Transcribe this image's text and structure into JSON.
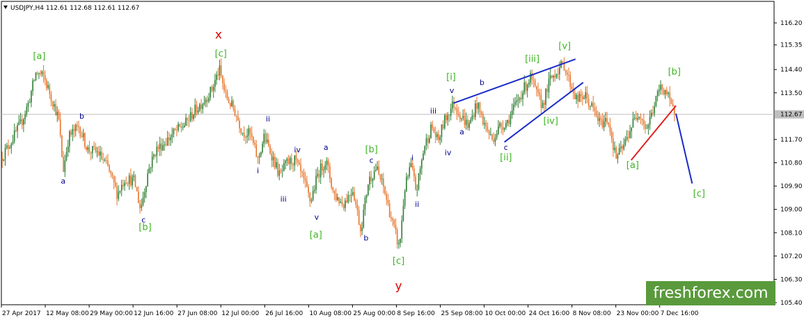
{
  "header": {
    "symbol_line": "USDJPY,H4  112.61 112.68 112.61 112.67"
  },
  "watermark": {
    "text": "freshforex.com"
  },
  "colors": {
    "up_candle": "#2e7d32",
    "down_candle": "#e8742a",
    "label_green": "#3cb521",
    "label_red": "#e00000",
    "label_blue": "#00008b",
    "trendline_blue": "#1a2bc8",
    "trendline_red": "#e02020",
    "price_box": "#c0c0c0"
  },
  "chart_data": {
    "type": "candlestick",
    "title": "USDJPY,H4",
    "ohlc_last": {
      "open": 112.61,
      "high": 112.68,
      "low": 112.61,
      "close": 112.67
    },
    "current_price_label": "112.67",
    "ylim": [
      105.4,
      117.1
    ],
    "xlim": [
      0,
      1
    ],
    "y_ticks": [
      "116.20",
      "115.35",
      "114.40",
      "113.50",
      "112.67",
      "111.70",
      "110.80",
      "109.90",
      "109.00",
      "108.10",
      "107.20",
      "106.30",
      "105.40"
    ],
    "y_tick_values": [
      116.2,
      115.35,
      114.4,
      113.5,
      112.67,
      111.7,
      110.8,
      109.9,
      109.0,
      108.1,
      107.2,
      106.3,
      105.4
    ],
    "x_ticks": [
      "27 Apr 2017",
      "12 May 08:00",
      "29 May 00:00",
      "12 Jun 16:00",
      "27 Jun 08:00",
      "12 Jul 00:00",
      "26 Jul 16:00",
      "10 Aug 08:00",
      "25 Aug 00:00",
      "8 Sep 16:00",
      "25 Sep 08:00",
      "10 Oct 00:00",
      "24 Oct 16:00",
      "8 Nov 08:00",
      "23 Nov 00:00",
      "7 Dec 16:00"
    ],
    "x_tick_values": [
      0.0,
      0.0568,
      0.1136,
      0.1704,
      0.2272,
      0.284,
      0.3408,
      0.3976,
      0.4544,
      0.5112,
      0.568,
      0.6248,
      0.6816,
      0.7384,
      0.7952,
      0.852
    ],
    "price_path": [
      [
        0.0,
        111.0
      ],
      [
        0.012,
        111.6
      ],
      [
        0.025,
        112.3
      ],
      [
        0.035,
        113.1
      ],
      [
        0.045,
        114.3
      ],
      [
        0.055,
        114.1
      ],
      [
        0.065,
        113.3
      ],
      [
        0.074,
        112.5
      ],
      [
        0.08,
        110.5
      ],
      [
        0.087,
        111.8
      ],
      [
        0.1,
        112.2
      ],
      [
        0.112,
        111.3
      ],
      [
        0.125,
        111.2
      ],
      [
        0.138,
        110.6
      ],
      [
        0.15,
        109.6
      ],
      [
        0.16,
        110.2
      ],
      [
        0.172,
        110.1
      ],
      [
        0.18,
        109.0
      ],
      [
        0.19,
        110.5
      ],
      [
        0.2,
        111.3
      ],
      [
        0.212,
        111.6
      ],
      [
        0.225,
        112.0
      ],
      [
        0.238,
        112.3
      ],
      [
        0.25,
        112.8
      ],
      [
        0.262,
        113.2
      ],
      [
        0.272,
        113.6
      ],
      [
        0.282,
        114.4
      ],
      [
        0.29,
        113.4
      ],
      [
        0.302,
        112.8
      ],
      [
        0.312,
        112.0
      ],
      [
        0.322,
        111.9
      ],
      [
        0.332,
        110.9
      ],
      [
        0.34,
        111.8
      ],
      [
        0.35,
        111.1
      ],
      [
        0.36,
        110.3
      ],
      [
        0.37,
        110.8
      ],
      [
        0.38,
        110.9
      ],
      [
        0.39,
        110.2
      ],
      [
        0.4,
        109.3
      ],
      [
        0.41,
        110.4
      ],
      [
        0.42,
        110.9
      ],
      [
        0.43,
        109.6
      ],
      [
        0.442,
        109.2
      ],
      [
        0.455,
        109.8
      ],
      [
        0.465,
        108.2
      ],
      [
        0.475,
        110.1
      ],
      [
        0.485,
        110.6
      ],
      [
        0.495,
        109.8
      ],
      [
        0.505,
        108.6
      ],
      [
        0.515,
        107.5
      ],
      [
        0.522,
        109.8
      ],
      [
        0.53,
        110.7
      ],
      [
        0.537,
        109.7
      ],
      [
        0.547,
        111.4
      ],
      [
        0.557,
        112.2
      ],
      [
        0.565,
        111.6
      ],
      [
        0.573,
        112.4
      ],
      [
        0.585,
        113.1
      ],
      [
        0.595,
        112.6
      ],
      [
        0.605,
        112.2
      ],
      [
        0.615,
        113.1
      ],
      [
        0.625,
        112.3
      ],
      [
        0.635,
        111.7
      ],
      [
        0.645,
        112.2
      ],
      [
        0.655,
        112.4
      ],
      [
        0.665,
        113.0
      ],
      [
        0.675,
        113.6
      ],
      [
        0.685,
        114.1
      ],
      [
        0.692,
        113.5
      ],
      [
        0.7,
        113.0
      ],
      [
        0.71,
        114.0
      ],
      [
        0.72,
        114.4
      ],
      [
        0.728,
        114.6
      ],
      [
        0.736,
        113.9
      ],
      [
        0.745,
        113.2
      ],
      [
        0.755,
        113.4
      ],
      [
        0.765,
        112.9
      ],
      [
        0.775,
        112.3
      ],
      [
        0.785,
        112.5
      ],
      [
        0.795,
        111.0
      ],
      [
        0.805,
        111.4
      ],
      [
        0.815,
        112.2
      ],
      [
        0.825,
        112.8
      ],
      [
        0.835,
        112.1
      ],
      [
        0.845,
        113.0
      ],
      [
        0.852,
        113.7
      ],
      [
        0.86,
        113.6
      ],
      [
        0.866,
        113.0
      ],
      [
        0.872,
        112.67
      ]
    ],
    "trendlines": [
      {
        "color": "blue",
        "from": [
          0.585,
          113.1
        ],
        "to": [
          0.743,
          114.8
        ]
      },
      {
        "color": "blue",
        "from": [
          0.651,
          111.6
        ],
        "to": [
          0.753,
          113.9
        ]
      },
      {
        "color": "red",
        "from": [
          0.815,
          110.9
        ],
        "to": [
          0.873,
          113.0
        ]
      }
    ],
    "projection": {
      "color": "blue",
      "points": [
        [
          0.873,
          112.7
        ],
        [
          0.894,
          110.0
        ]
      ]
    },
    "annotations": [
      {
        "text": "[a]",
        "x": 0.049,
        "y": 114.8,
        "color": "green",
        "size": 13
      },
      {
        "text": "a",
        "x": 0.08,
        "y": 110.0,
        "color": "blue",
        "size": 11
      },
      {
        "text": "b",
        "x": 0.104,
        "y": 112.5,
        "color": "blue",
        "size": 11
      },
      {
        "text": "c",
        "x": 0.184,
        "y": 108.5,
        "color": "blue",
        "size": 11
      },
      {
        "text": "[b]",
        "x": 0.186,
        "y": 108.2,
        "color": "green",
        "size": 13
      },
      {
        "text": "x",
        "x": 0.281,
        "y": 115.6,
        "color": "red",
        "size": 17
      },
      {
        "text": "[c]",
        "x": 0.284,
        "y": 114.9,
        "color": "green",
        "size": 13
      },
      {
        "text": "ii",
        "x": 0.345,
        "y": 112.4,
        "color": "blue",
        "size": 11
      },
      {
        "text": "i",
        "x": 0.332,
        "y": 110.4,
        "color": "blue",
        "size": 11
      },
      {
        "text": "iii",
        "x": 0.365,
        "y": 109.3,
        "color": "blue",
        "size": 11
      },
      {
        "text": "iv",
        "x": 0.383,
        "y": 111.2,
        "color": "blue",
        "size": 11
      },
      {
        "text": "a",
        "x": 0.42,
        "y": 111.3,
        "color": "blue",
        "size": 11
      },
      {
        "text": "v",
        "x": 0.408,
        "y": 108.6,
        "color": "blue",
        "size": 11
      },
      {
        "text": "[a]",
        "x": 0.407,
        "y": 107.9,
        "color": "green",
        "size": 13
      },
      {
        "text": "[b]",
        "x": 0.479,
        "y": 111.2,
        "color": "green",
        "size": 13
      },
      {
        "text": "c",
        "x": 0.479,
        "y": 110.8,
        "color": "blue",
        "size": 11
      },
      {
        "text": "b",
        "x": 0.472,
        "y": 107.8,
        "color": "blue",
        "size": 11
      },
      {
        "text": "[c]",
        "x": 0.514,
        "y": 106.9,
        "color": "green",
        "size": 13
      },
      {
        "text": "y",
        "x": 0.514,
        "y": 105.9,
        "color": "red",
        "size": 17
      },
      {
        "text": "i",
        "x": 0.532,
        "y": 110.9,
        "color": "blue",
        "size": 11
      },
      {
        "text": "ii",
        "x": 0.538,
        "y": 109.1,
        "color": "blue",
        "size": 11
      },
      {
        "text": "iii",
        "x": 0.559,
        "y": 112.7,
        "color": "blue",
        "size": 11
      },
      {
        "text": "iv",
        "x": 0.578,
        "y": 111.1,
        "color": "blue",
        "size": 11
      },
      {
        "text": "[i]",
        "x": 0.582,
        "y": 114.0,
        "color": "green",
        "size": 13
      },
      {
        "text": "v",
        "x": 0.583,
        "y": 113.5,
        "color": "blue",
        "size": 11
      },
      {
        "text": "a",
        "x": 0.596,
        "y": 111.9,
        "color": "blue",
        "size": 11
      },
      {
        "text": "b",
        "x": 0.622,
        "y": 113.8,
        "color": "blue",
        "size": 11
      },
      {
        "text": "c",
        "x": 0.653,
        "y": 111.3,
        "color": "blue",
        "size": 11
      },
      {
        "text": "[ii]",
        "x": 0.653,
        "y": 110.9,
        "color": "green",
        "size": 13
      },
      {
        "text": "[iii]",
        "x": 0.687,
        "y": 114.7,
        "color": "green",
        "size": 13
      },
      {
        "text": "[iv]",
        "x": 0.711,
        "y": 112.3,
        "color": "green",
        "size": 13
      },
      {
        "text": "[v]",
        "x": 0.729,
        "y": 115.2,
        "color": "green",
        "size": 13
      },
      {
        "text": "[a]",
        "x": 0.817,
        "y": 110.6,
        "color": "green",
        "size": 13
      },
      {
        "text": "[b]",
        "x": 0.871,
        "y": 114.2,
        "color": "green",
        "size": 13
      },
      {
        "text": "[c]",
        "x": 0.903,
        "y": 109.5,
        "color": "green",
        "size": 13
      }
    ]
  }
}
